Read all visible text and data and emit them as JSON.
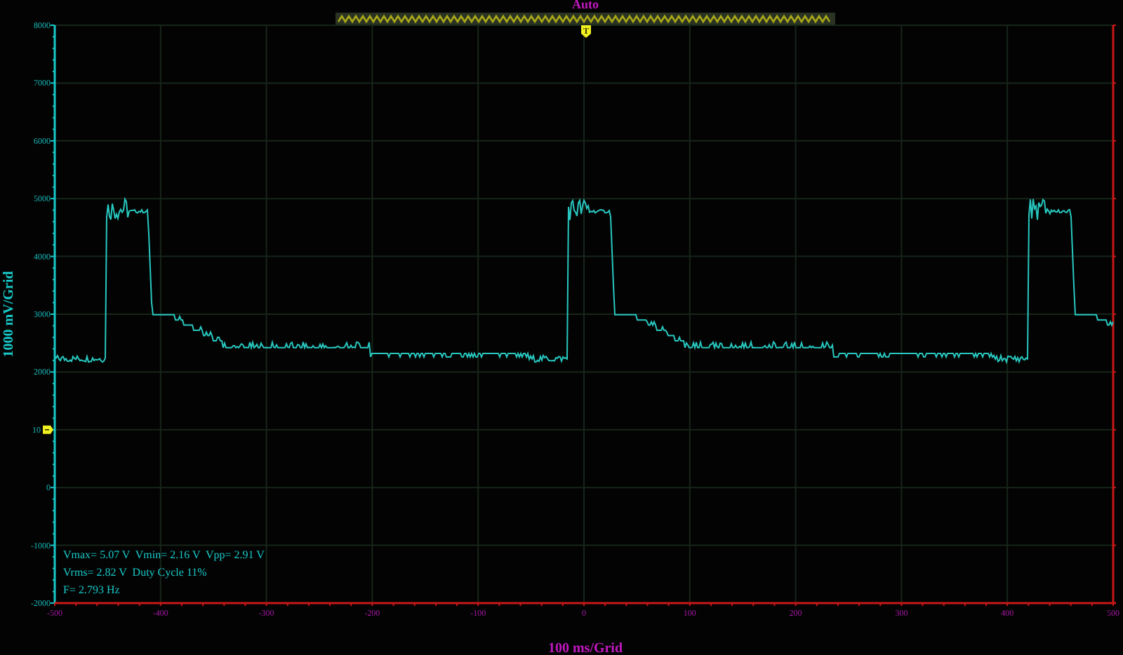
{
  "header": {
    "mode": "Auto"
  },
  "trigger": {
    "marker": "T"
  },
  "y_axis": {
    "label": "1000 mV/Grid",
    "ticks": [
      "8000",
      "7000",
      "6000",
      "5000",
      "4000",
      "3000",
      "2000",
      "10",
      "0",
      "-1000",
      "-2000"
    ]
  },
  "x_axis": {
    "label": "100 ms/Grid",
    "ticks": [
      "-500",
      "-400",
      "-300",
      "-200",
      "-100",
      "0",
      "100",
      "200",
      "300",
      "400",
      "500"
    ]
  },
  "measurements": [
    "Vmax= 5.07 V  Vmin= 2.16 V  Vpp= 2.91 V",
    "Vrms= 2.82 V  Duty Cycle 11%",
    "F= 2.793 Hz"
  ]
}
